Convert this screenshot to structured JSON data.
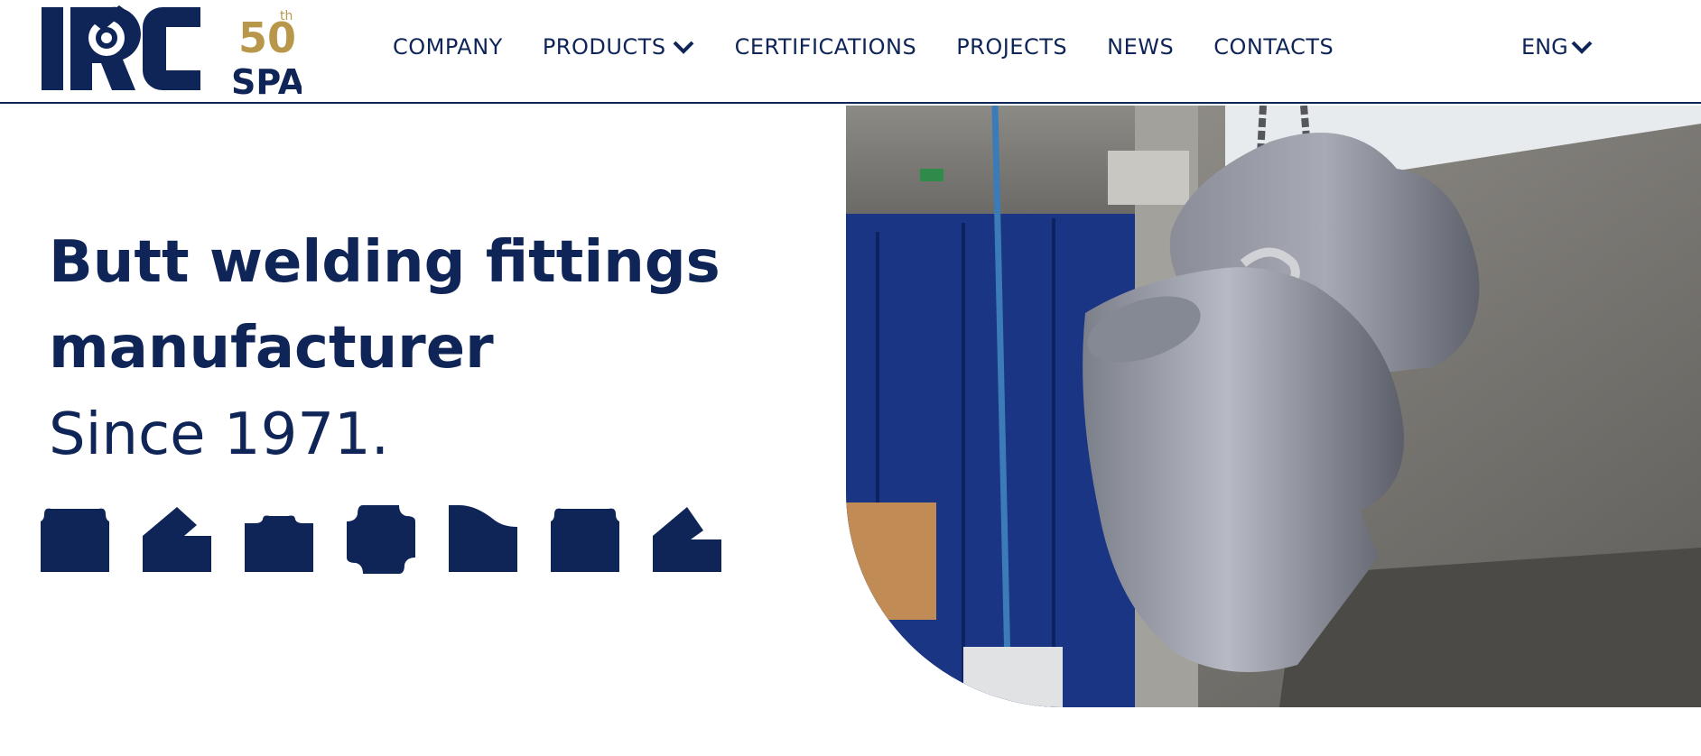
{
  "brand": {
    "logo_text": "IRC",
    "logo_suffix": "SPA",
    "anniversary": "50",
    "anniversary_suffix": "th",
    "logo_icon": "irc-spa-50th-logo",
    "colors": {
      "navy": "#0f2557",
      "gold": "#b8974a"
    }
  },
  "nav": {
    "items": [
      {
        "label": "COMPANY"
      },
      {
        "label": "PRODUCTS",
        "dropdown": true
      },
      {
        "label": "CERTIFICATIONS"
      },
      {
        "label": "PROJECTS"
      },
      {
        "label": "NEWS"
      },
      {
        "label": "CONTACTS"
      }
    ],
    "language": "ENG"
  },
  "hero": {
    "title_line1": "Butt welding fittings",
    "title_line2": "manufacturer",
    "subtitle": "Since 1971.",
    "product_icons": [
      "cap-icon",
      "elbow-icon",
      "reducer-icon",
      "cross-icon",
      "eccentric-reducer-icon",
      "tee-icon",
      "elbow-45-icon"
    ],
    "image": "hanging-steel-tee-fittings-photo"
  }
}
